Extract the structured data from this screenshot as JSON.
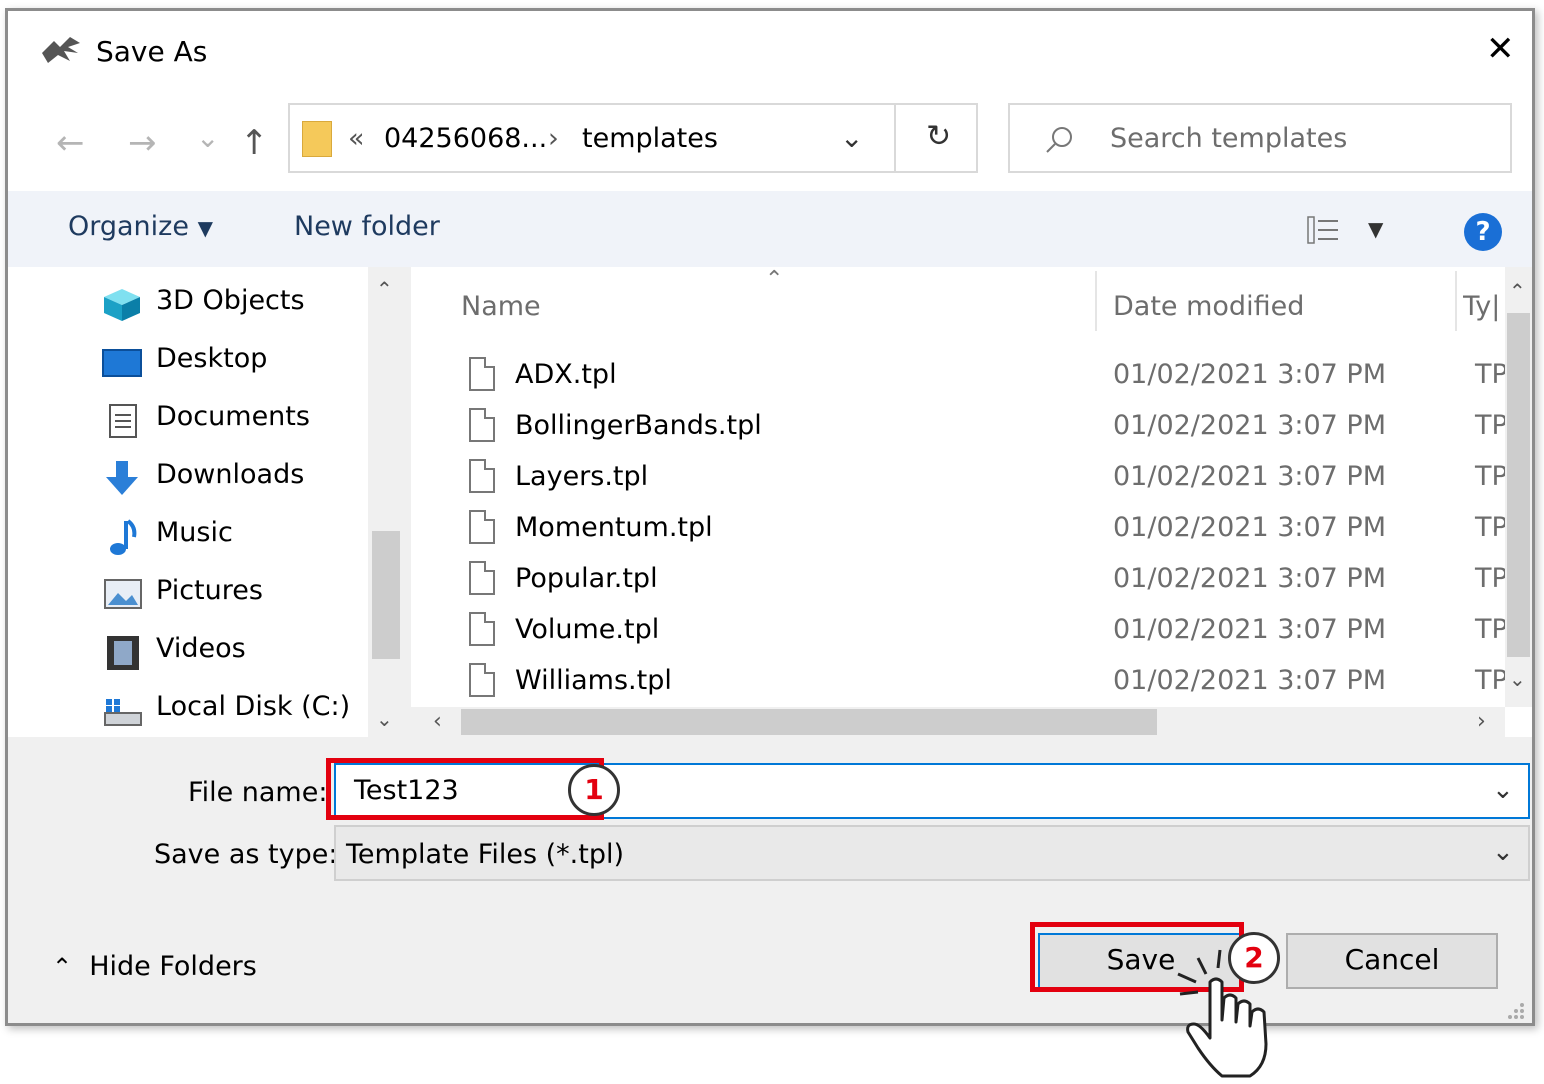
{
  "window": {
    "title": "Save As",
    "close_glyph": "✕"
  },
  "nav": {
    "back_glyph": "←",
    "forward_glyph": "→",
    "recent_glyph": "⌄",
    "up_glyph": "↑",
    "breadcrumb_overflow": "«",
    "breadcrumb_parent": "04256068...",
    "breadcrumb_sep": "›",
    "breadcrumb_current": "templates",
    "dropdown_glyph": "⌄",
    "refresh_glyph": "↻"
  },
  "search": {
    "placeholder": "Search templates"
  },
  "toolbar": {
    "organize_label": "Organize",
    "new_folder_label": "New folder",
    "help_glyph": "?"
  },
  "sidebar": {
    "items": [
      {
        "label": "3D Objects",
        "icon": "cube-icon"
      },
      {
        "label": "Desktop",
        "icon": "desktop-icon"
      },
      {
        "label": "Documents",
        "icon": "documents-icon"
      },
      {
        "label": "Downloads",
        "icon": "download-arrow-icon"
      },
      {
        "label": "Music",
        "icon": "music-note-icon"
      },
      {
        "label": "Pictures",
        "icon": "pictures-icon"
      },
      {
        "label": "Videos",
        "icon": "film-icon"
      },
      {
        "label": "Local Disk (C:)",
        "icon": "drive-icon"
      }
    ]
  },
  "files": {
    "columns": {
      "name": "Name",
      "date": "Date modified",
      "type": "Ty|"
    },
    "rows": [
      {
        "name": "ADX.tpl",
        "date": "01/02/2021 3:07 PM",
        "type": "TP"
      },
      {
        "name": "BollingerBands.tpl",
        "date": "01/02/2021 3:07 PM",
        "type": "TP"
      },
      {
        "name": "Layers.tpl",
        "date": "01/02/2021 3:07 PM",
        "type": "TP"
      },
      {
        "name": "Momentum.tpl",
        "date": "01/02/2021 3:07 PM",
        "type": "TP"
      },
      {
        "name": "Popular.tpl",
        "date": "01/02/2021 3:07 PM",
        "type": "TP"
      },
      {
        "name": "Volume.tpl",
        "date": "01/02/2021 3:07 PM",
        "type": "TP"
      },
      {
        "name": "Williams.tpl",
        "date": "01/02/2021 3:07 PM",
        "type": "TP"
      }
    ]
  },
  "form": {
    "file_name_label": "File name:",
    "file_name_value": "Test123",
    "save_type_label": "Save as type:",
    "save_type_value": "Template Files (*.tpl)"
  },
  "footer": {
    "hide_folders_label": "Hide Folders",
    "save_label": "Save",
    "cancel_label": "Cancel"
  },
  "annotations": {
    "step1": "1",
    "step2": "2"
  },
  "colors": {
    "highlight": "#e3000f",
    "focus": "#0078d7",
    "help": "#1a6fd6"
  }
}
